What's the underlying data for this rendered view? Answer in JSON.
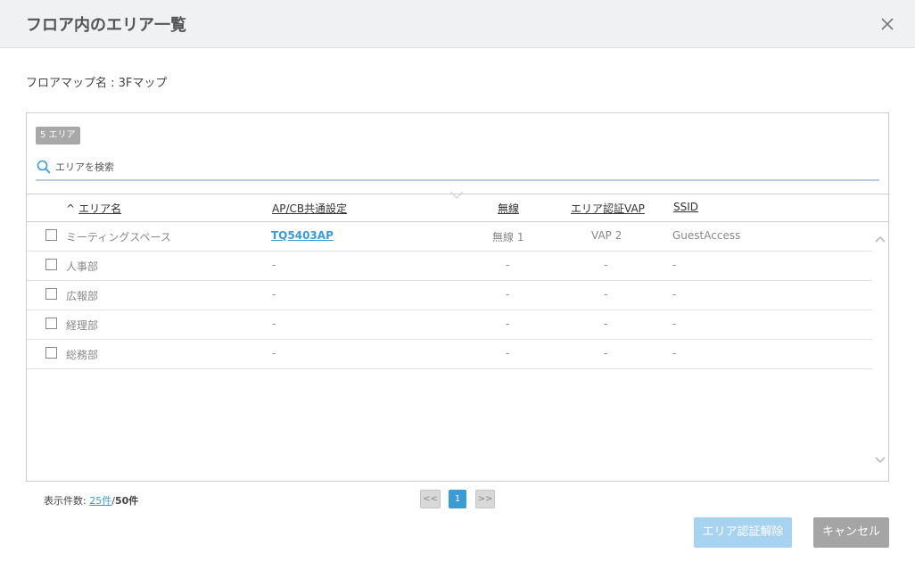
{
  "dialog": {
    "title": "フロア内のエリア一覧"
  },
  "floor_map": {
    "label": "フロアマップ名 : 3Fマップ"
  },
  "panel": {
    "badge": "5 エリア",
    "search": {
      "placeholder": "エリアを検索",
      "value": ""
    }
  },
  "table": {
    "headers": {
      "area": "エリア名",
      "apcb": "AP/CB共通設定",
      "wireless": "無線",
      "vap": "エリア認証VAP",
      "ssid": "SSID"
    },
    "rows": [
      {
        "checked": false,
        "area": "ミーティングスペース",
        "apcb": "TQ5403AP",
        "wireless": "無線 1",
        "vap": "VAP 2",
        "ssid": "GuestAccess"
      },
      {
        "checked": false,
        "area": "人事部",
        "apcb": "-",
        "wireless": "-",
        "vap": "-",
        "ssid": "-"
      },
      {
        "checked": false,
        "area": "広報部",
        "apcb": "-",
        "wireless": "-",
        "vap": "-",
        "ssid": "-"
      },
      {
        "checked": false,
        "area": "経理部",
        "apcb": "-",
        "wireless": "-",
        "vap": "-",
        "ssid": "-"
      },
      {
        "checked": false,
        "area": "総務部",
        "apcb": "-",
        "wireless": "-",
        "vap": "-",
        "ssid": "-"
      }
    ]
  },
  "footer": {
    "count_label": "表示件数:",
    "per_page": "25件",
    "separator": "/",
    "total": "50件"
  },
  "pagination": {
    "prev": "<<",
    "current": "1",
    "next": ">>"
  },
  "buttons": {
    "release": "エリア認証解除",
    "cancel": "キャンセル"
  },
  "colors": {
    "accent": "#3a9bd5",
    "header_bg": "#f0f1f3",
    "disabled_button": "#a7d2f0",
    "cancel_button": "#a5a5a5"
  },
  "icons": {
    "close": "close-icon",
    "search": "search-icon",
    "sort": "sort-asc-icon",
    "scroll_up": "chevron-up-icon",
    "scroll_down": "chevron-down-icon"
  }
}
